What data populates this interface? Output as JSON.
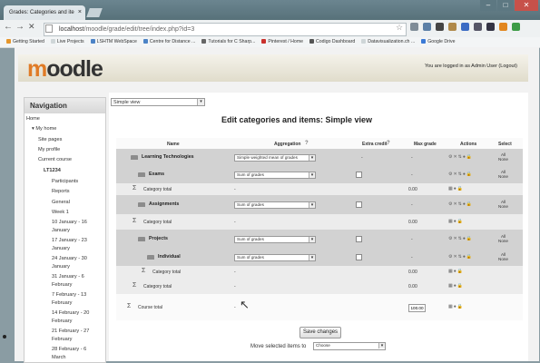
{
  "browser": {
    "tab_title": "Grades: Categories and ite",
    "tab_close": "×",
    "back": "←",
    "forward": "→",
    "stop": "✕",
    "url_host": "localhost",
    "url_path": "/moodle/grade/edit/tree/index.php?id=3",
    "star": "☆",
    "window_min": "–",
    "window_max": "□",
    "window_close": "✕",
    "extension_colors": [
      "#7f8c97",
      "#5b7fa6",
      "#444",
      "#b0894a",
      "#3b6bc4",
      "#556",
      "#334",
      "#e2861f",
      "#3c9b46"
    ]
  },
  "bookmarks": [
    {
      "label": "Getting Started",
      "color": "#e6962b"
    },
    {
      "label": "Live Projects",
      "color": "#cfd6d8"
    },
    {
      "label": "LSHTM WebSpace",
      "color": "#4c83c6"
    },
    {
      "label": "Centre for Distance ...",
      "color": "#4c83c6"
    },
    {
      "label": "Tutorials for C Sharp...",
      "color": "#666"
    },
    {
      "label": "Pinterest / Home",
      "color": "#c9302c"
    },
    {
      "label": "Codigo Dashboard",
      "color": "#555"
    },
    {
      "label": "Datavisualization.ch ...",
      "color": "#cfd6d8"
    },
    {
      "label": "Google Drive",
      "color": "#3b7ad6"
    }
  ],
  "header": {
    "logo_prefix": "m",
    "logo_rest": "oodle",
    "login_text": "You are logged in as Admin User (",
    "logout_link": "Logout",
    "login_end": ")"
  },
  "sidebar": {
    "title": "Navigation",
    "items": [
      {
        "label": "Home"
      },
      {
        "label": "▾ My home"
      },
      {
        "label": "Site pages"
      },
      {
        "label": "My profile"
      },
      {
        "label": "Current course"
      },
      {
        "label": "LT1234"
      },
      {
        "label": "Participants"
      },
      {
        "label": "Reports"
      },
      {
        "label": "General"
      },
      {
        "label": "Week 1"
      },
      {
        "label": "10 January - 16"
      },
      {
        "label": "January"
      },
      {
        "label": "17 January - 23"
      },
      {
        "label": "January"
      },
      {
        "label": "24 January - 30"
      },
      {
        "label": "January"
      },
      {
        "label": "31 January - 6"
      },
      {
        "label": "February"
      },
      {
        "label": "7 February - 13"
      },
      {
        "label": "February"
      },
      {
        "label": "14 February - 20"
      },
      {
        "label": "February"
      },
      {
        "label": "21 February - 27"
      },
      {
        "label": "February"
      },
      {
        "label": "28 February - 6"
      },
      {
        "label": "March"
      }
    ]
  },
  "main": {
    "view_select": "Simple view",
    "title": "Edit categories and items: Simple view",
    "columns": {
      "name": "Name",
      "aggregation": "Aggregation",
      "extra_credit": "Extra credit",
      "max_grade": "Max grade",
      "actions": "Actions",
      "select": "Select"
    },
    "help_icon": "?",
    "rows": [
      {
        "kind": "category",
        "name": "Learning Technologies",
        "aggregation": "Simple weighted mean of grades",
        "extra": "-",
        "max": "-",
        "actions": "⚙✕⇅●🔒",
        "sel1": "All",
        "sel2": "None"
      },
      {
        "kind": "category",
        "name": "Exams",
        "aggregation": "Sum of grades",
        "extra": "checkbox",
        "max": "-",
        "actions": "⚙✕⇅●🔒",
        "sel1": "All",
        "sel2": "None"
      },
      {
        "kind": "total",
        "name": "Category total",
        "aggregation": "-",
        "extra": "",
        "max": "0.00",
        "actions": "▦●🔒",
        "sel1": "",
        "sel2": ""
      },
      {
        "kind": "category",
        "name": "Assignments",
        "aggregation": "Sum of grades",
        "extra": "checkbox",
        "max": "-",
        "actions": "⚙✕⇅●🔒",
        "sel1": "All",
        "sel2": "None"
      },
      {
        "kind": "total",
        "name": "Category total",
        "aggregation": "-",
        "extra": "",
        "max": "0.00",
        "actions": "▦●🔒",
        "sel1": "",
        "sel2": ""
      },
      {
        "kind": "category",
        "name": "Projects",
        "aggregation": "Sum of grades",
        "extra": "checkbox",
        "max": "-",
        "actions": "⚙✕⇅●🔒",
        "sel1": "All",
        "sel2": "None"
      },
      {
        "kind": "category",
        "name": "Individual",
        "aggregation": "Sum of grades",
        "extra": "checkbox",
        "max": "-",
        "actions": "⚙✕⇅●🔒",
        "sel1": "All",
        "sel2": "None"
      },
      {
        "kind": "total",
        "name": "Category total",
        "aggregation": "-",
        "extra": "",
        "max": "0.00",
        "actions": "▦●🔒",
        "sel1": "",
        "sel2": ""
      },
      {
        "kind": "total",
        "name": "Category total",
        "aggregation": "-",
        "extra": "",
        "max": "0.00",
        "actions": "▦●🔒",
        "sel1": "",
        "sel2": ""
      },
      {
        "kind": "course",
        "name": "Course total",
        "aggregation": "-",
        "extra": "",
        "max": "100.00",
        "actions": "▦●🔒",
        "sel1": "",
        "sel2": ""
      }
    ],
    "save_button": "Save changes",
    "move_label": "Move selected items to",
    "move_select": "Choose"
  }
}
